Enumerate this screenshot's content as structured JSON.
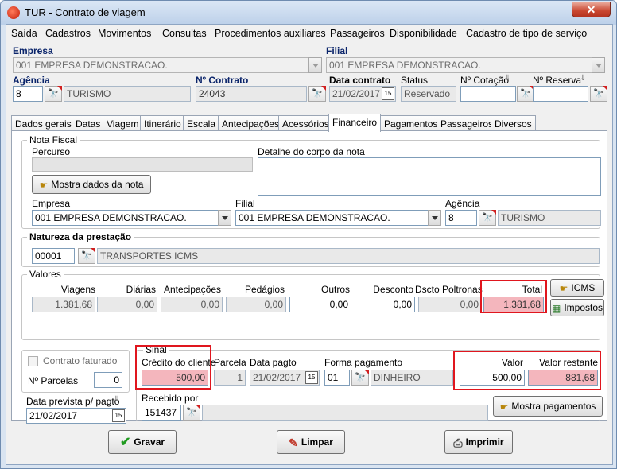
{
  "window": {
    "title": "TUR - Contrato de viagem",
    "close": "✕"
  },
  "menu": [
    "Saída",
    "Cadastros",
    "Movimentos",
    "Consultas",
    "Procedimentos auxiliares",
    "Passageiros",
    "Disponibilidade",
    "Cadastro de tipo de serviço"
  ],
  "header": {
    "empresa_label": "Empresa",
    "empresa_value": "001 EMPRESA DEMONSTRACAO.",
    "filial_label": "Filial",
    "filial_value": "001 EMPRESA DEMONSTRACAO.",
    "agencia_label": "Agência",
    "agencia_code": "8",
    "agencia_name": "TURISMO",
    "contrato_label": "Nº Contrato",
    "contrato_value": "24043",
    "data_contrato_label": "Data contrato",
    "data_contrato_value": "21/02/2017",
    "status_label": "Status",
    "status_value": "Reservado",
    "cotacao_label": "Nº Cotação",
    "reserva_label": "Nº Reserva"
  },
  "tabs": [
    "Dados gerais",
    "Datas",
    "Viagem",
    "Itinerário",
    "Escala",
    "Antecipações",
    "Acessórios",
    "Financeiro",
    "Pagamentos",
    "Passageiros",
    "Diversos"
  ],
  "nota": {
    "title": "Nota Fiscal",
    "percurso_label": "Percurso",
    "detalhe_label": "Detalhe do corpo da nota",
    "mostra_btn": "Mostra dados da nota",
    "empresa_label": "Empresa",
    "empresa_value": "001 EMPRESA DEMONSTRACAO.",
    "filial_label": "Filial",
    "filial_value": "001 EMPRESA DEMONSTRACAO.",
    "agencia_label": "Agência",
    "agencia_code": "8",
    "agencia_name": "TURISMO"
  },
  "natureza": {
    "title": "Natureza da prestação",
    "code": "00001",
    "name": "TRANSPORTES ICMS"
  },
  "valores": {
    "title": "Valores",
    "labels": [
      "Viagens",
      "Diárias",
      "Antecipações",
      "Pedágios",
      "Outros",
      "Desconto",
      "Dscto Poltronas",
      "Total"
    ],
    "values": [
      "1.381,68",
      "0,00",
      "0,00",
      "0,00",
      "0,00",
      "0,00",
      "0,00",
      "1.381,68"
    ],
    "icms_btn": "ICMS",
    "impostos_btn": "Impostos"
  },
  "left": {
    "faturado_label": "Contrato faturado",
    "parcelas_label": "Nº Parcelas",
    "parcelas_value": "0",
    "prevista_label": "Data prevista p/ pagto",
    "prevista_value": "21/02/2017"
  },
  "sinal": {
    "title": "Sinal",
    "credito_label": "Crédito do cliente",
    "credito_value": "500,00",
    "parcela_label": "Parcela",
    "parcela_value": "1",
    "data_pagto_label": "Data pagto",
    "data_pagto_value": "21/02/2017",
    "forma_label": "Forma pagamento",
    "forma_code": "01",
    "forma_name": "DINHEIRO",
    "valor_label": "Valor",
    "valor_value": "500,00",
    "restante_label": "Valor restante",
    "restante_value": "881,68",
    "recebido_label": "Recebido por",
    "recebido_value": "151437",
    "mostra_pag_btn": "Mostra pagamentos"
  },
  "footer": {
    "gravar": "Gravar",
    "limpar": "Limpar",
    "imprimir": "Imprimir"
  }
}
